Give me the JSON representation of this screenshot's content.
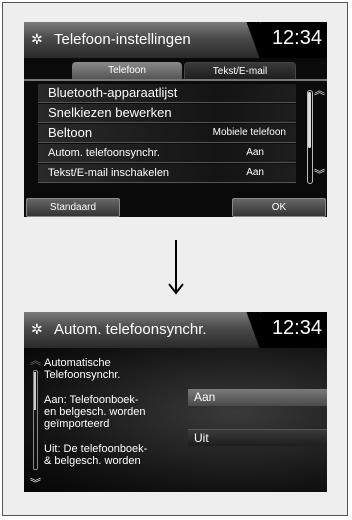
{
  "screen1": {
    "title": "Telefoon-instellingen",
    "clock": "12:34",
    "tabs": [
      {
        "label": "Telefoon"
      },
      {
        "label": "Tekst/E-mail"
      }
    ],
    "rows": [
      {
        "label": "Bluetooth-apparaatlijst",
        "value": ""
      },
      {
        "label": "Snelkiezen bewerken",
        "value": ""
      },
      {
        "label": "Beltoon",
        "value": "Mobiele telefoon"
      },
      {
        "label": "Autom. telefoonsynchr.",
        "value": "Aan"
      },
      {
        "label": "Tekst/E-mail inschakelen",
        "value": "Aan"
      }
    ],
    "buttons": {
      "standaard": "Standaard",
      "ok": "OK"
    }
  },
  "screen2": {
    "title": "Autom. telefoonsynchr.",
    "clock": "12:34",
    "description": [
      "Automatische",
      "Telefoonsynchr.",
      "Aan: Telefoonboek-",
      "en belgesch. worden",
      "geïmporteerd",
      "Uit: De telefoonboek-",
      "& belgesch. worden"
    ],
    "options": [
      "Aan",
      "Uit"
    ]
  },
  "icons": {
    "settings": "gear-icon",
    "scroll_up": "chevron-up-icon",
    "scroll_down": "chevron-down-icon",
    "flow": "down-arrow-icon"
  }
}
